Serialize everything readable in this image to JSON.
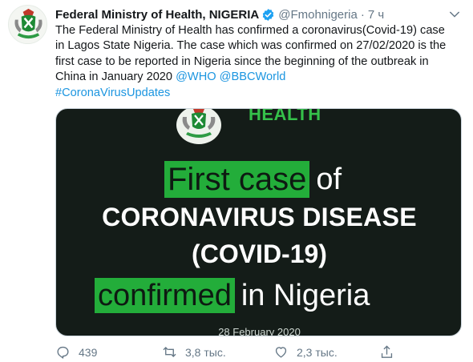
{
  "tweet": {
    "display_name": "Federal Ministry of Health, NIGERIA",
    "handle": "@Fmohnigeria",
    "dot": "·",
    "time": "7 ч",
    "text_main": "The Federal Ministry of Health has confirmed a coronavirus(Covid-19) case in Lagos State Nigeria. The case which was confirmed on 27/02/2020 is the first case to be reported in Nigeria since the beginning of the outbreak in China in January 2020",
    "mentions": [
      "@WHO",
      "@BBCWorld"
    ],
    "hashtag": "#CoronaVirusUpdates"
  },
  "media": {
    "header": "HEALTH",
    "highlight1": "First case",
    "plain1": "of",
    "line2": "CORONAVIRUS DISEASE",
    "line3": "(COVID-19)",
    "highlight4": "confirmed",
    "plain4": "in Nigeria",
    "date": "28 February 2020"
  },
  "actions": {
    "reply_count": "439",
    "retweet_count": "3,8 тыс.",
    "like_count": "2,3 тыс."
  },
  "colors": {
    "link": "#1b95e0",
    "verified": "#1da1f2",
    "media_bg": "#141c18",
    "media_highlight": "#23ad3a",
    "muted": "#657786"
  },
  "icons": [
    "seal-avatar-icon",
    "verified-badge-icon",
    "chevron-down-icon",
    "reply-icon",
    "retweet-icon",
    "like-icon",
    "share-icon",
    "coat-of-arms-icon"
  ]
}
